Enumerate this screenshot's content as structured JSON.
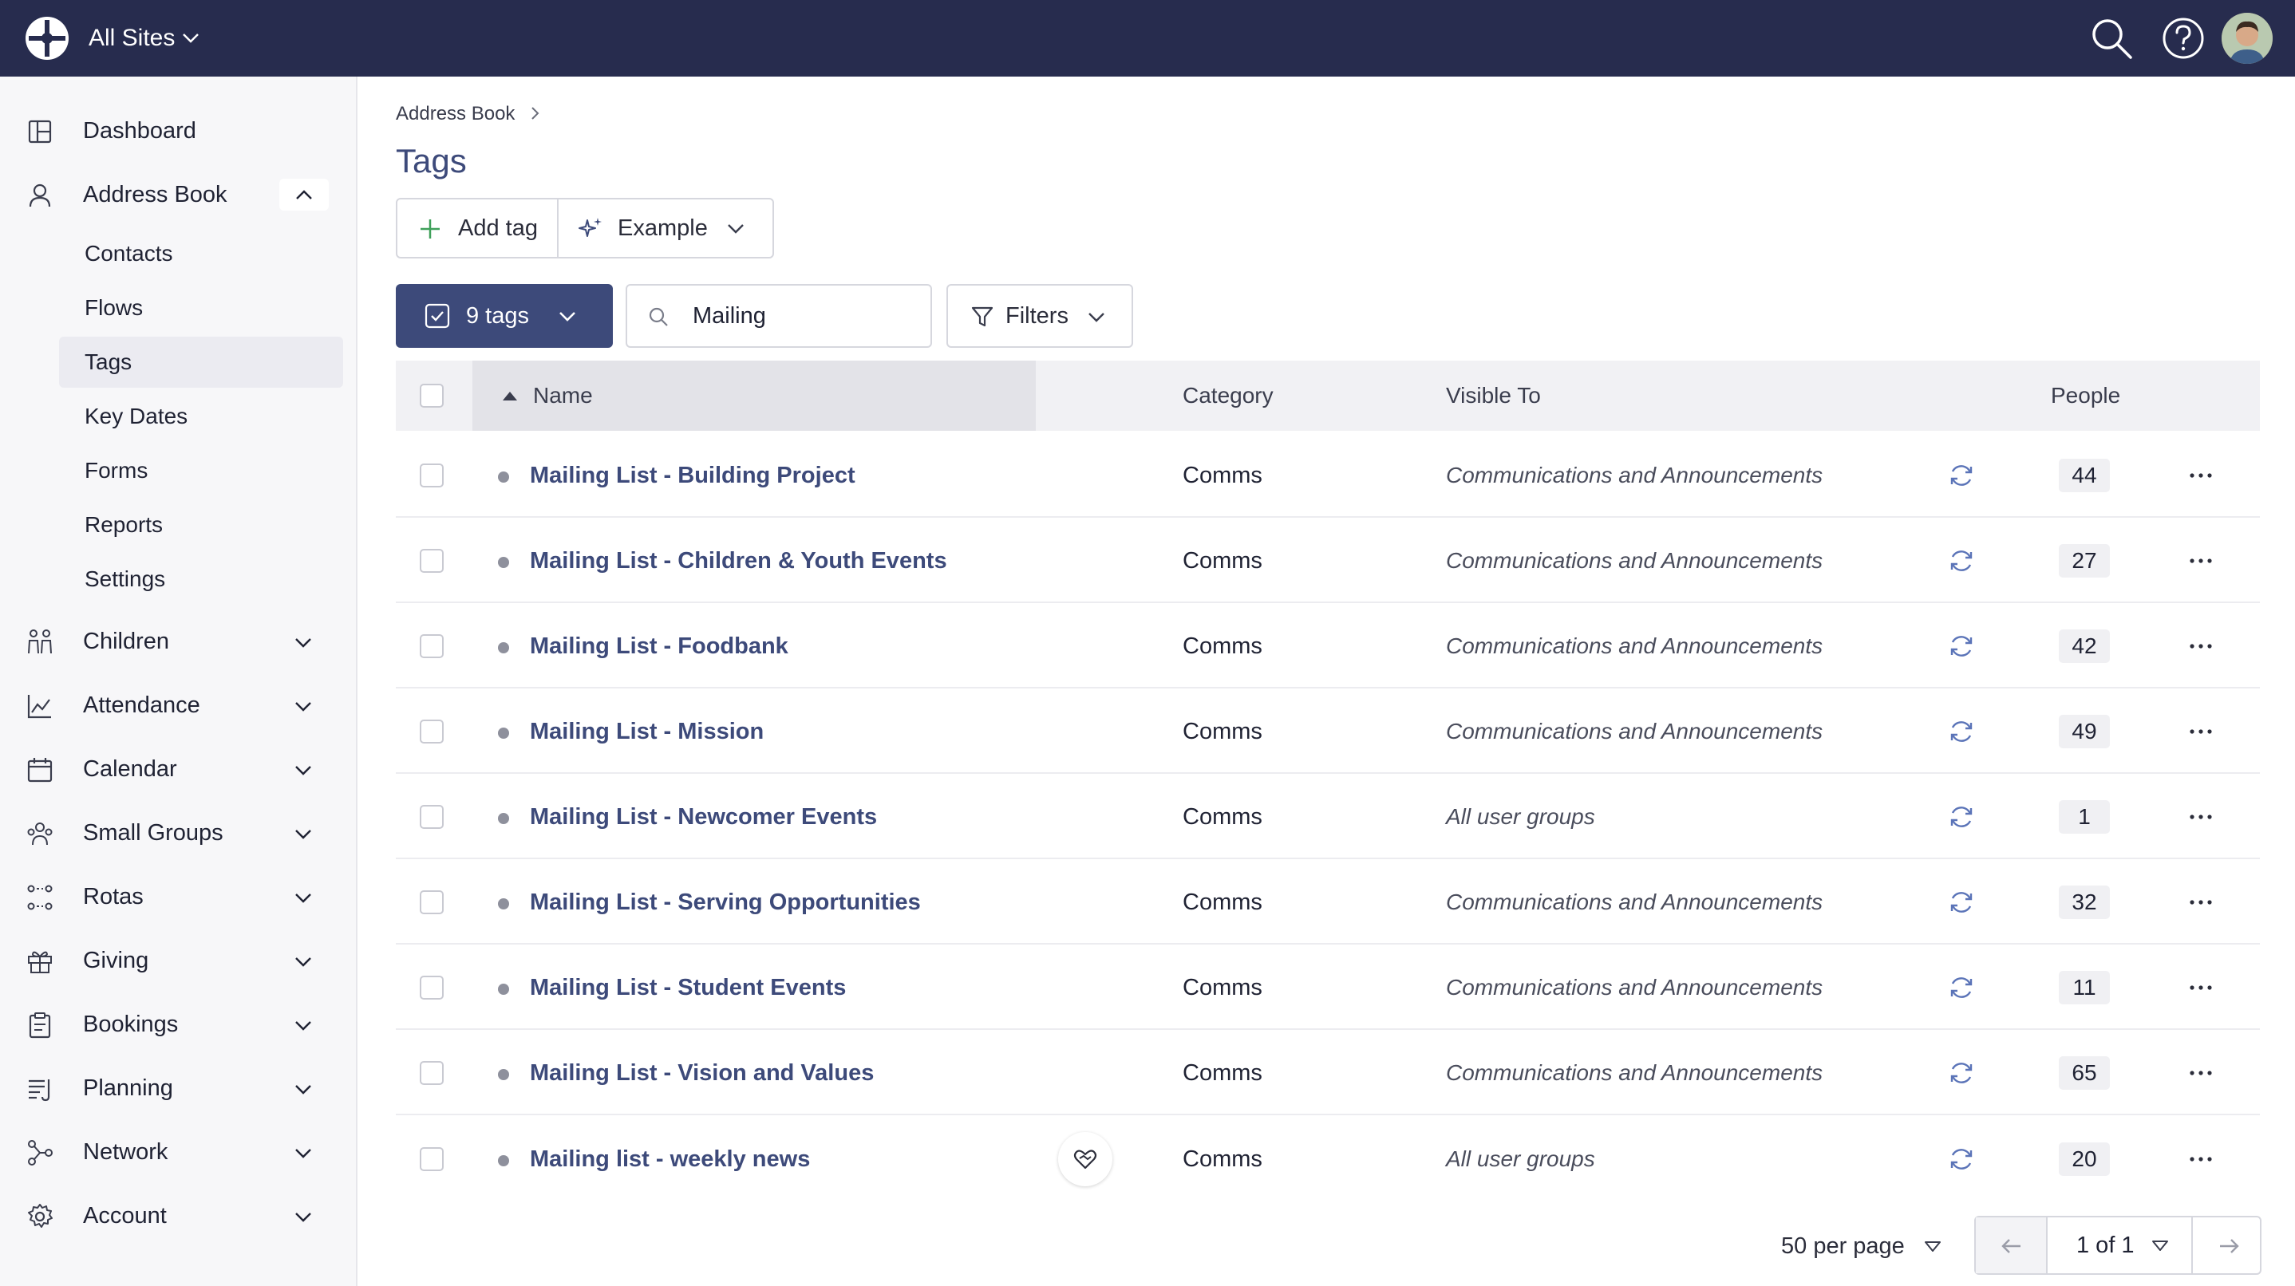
{
  "topbar": {
    "site_selector": "All Sites",
    "icons": [
      "logo-icon",
      "search-icon",
      "help-icon",
      "avatar"
    ]
  },
  "sidebar": {
    "items": [
      {
        "label": "Dashboard",
        "icon": "dashboard-icon"
      },
      {
        "label": "Address Book",
        "icon": "person-icon",
        "expanded": true,
        "children": [
          "Contacts",
          "Flows",
          "Tags",
          "Key Dates",
          "Forms",
          "Reports",
          "Settings"
        ],
        "active_child": "Tags"
      },
      {
        "label": "Children",
        "icon": "children-icon"
      },
      {
        "label": "Attendance",
        "icon": "chart-icon"
      },
      {
        "label": "Calendar",
        "icon": "calendar-icon"
      },
      {
        "label": "Small Groups",
        "icon": "groups-icon"
      },
      {
        "label": "Rotas",
        "icon": "rotas-icon"
      },
      {
        "label": "Giving",
        "icon": "gift-icon"
      },
      {
        "label": "Bookings",
        "icon": "clipboard-icon"
      },
      {
        "label": "Planning",
        "icon": "planning-icon"
      },
      {
        "label": "Network",
        "icon": "network-icon"
      },
      {
        "label": "Account",
        "icon": "gear-icon"
      }
    ]
  },
  "main": {
    "breadcrumb": "Address Book",
    "title": "Tags",
    "add_tag_label": "Add tag",
    "example_label": "Example",
    "selection_label": "9 tags",
    "search_value": "Mailing",
    "filters_label": "Filters",
    "columns": {
      "name": "Name",
      "category": "Category",
      "visible_to": "Visible To",
      "people": "People"
    },
    "rows": [
      {
        "name": "Mailing List - Building Project",
        "category": "Comms",
        "visible_to": "Communications and Announcements",
        "people": "44",
        "badge": false
      },
      {
        "name": "Mailing List - Children & Youth Events",
        "category": "Comms",
        "visible_to": "Communications and Announcements",
        "people": "27",
        "badge": false
      },
      {
        "name": "Mailing List - Foodbank",
        "category": "Comms",
        "visible_to": "Communications and Announcements",
        "people": "42",
        "badge": false
      },
      {
        "name": "Mailing List - Mission",
        "category": "Comms",
        "visible_to": "Communications and Announcements",
        "people": "49",
        "badge": false
      },
      {
        "name": "Mailing List - Newcomer Events",
        "category": "Comms",
        "visible_to": "All user groups",
        "people": "1",
        "badge": false
      },
      {
        "name": "Mailing List - Serving Opportunities",
        "category": "Comms",
        "visible_to": "Communications and Announcements",
        "people": "32",
        "badge": false
      },
      {
        "name": "Mailing List - Student Events",
        "category": "Comms",
        "visible_to": "Communications and Announcements",
        "people": "11",
        "badge": false
      },
      {
        "name": "Mailing List - Vision and Values",
        "category": "Comms",
        "visible_to": "Communications and Announcements",
        "people": "65",
        "badge": false
      },
      {
        "name": "Mailing list - weekly news",
        "category": "Comms",
        "visible_to": "All user groups",
        "people": "20",
        "badge": true
      }
    ],
    "per_page": "50 per page",
    "page_indicator": "1 of 1"
  },
  "colors": {
    "topbar": "#272c4e",
    "accent": "#3d4a7a",
    "sync_icon": "#5b74b8"
  }
}
